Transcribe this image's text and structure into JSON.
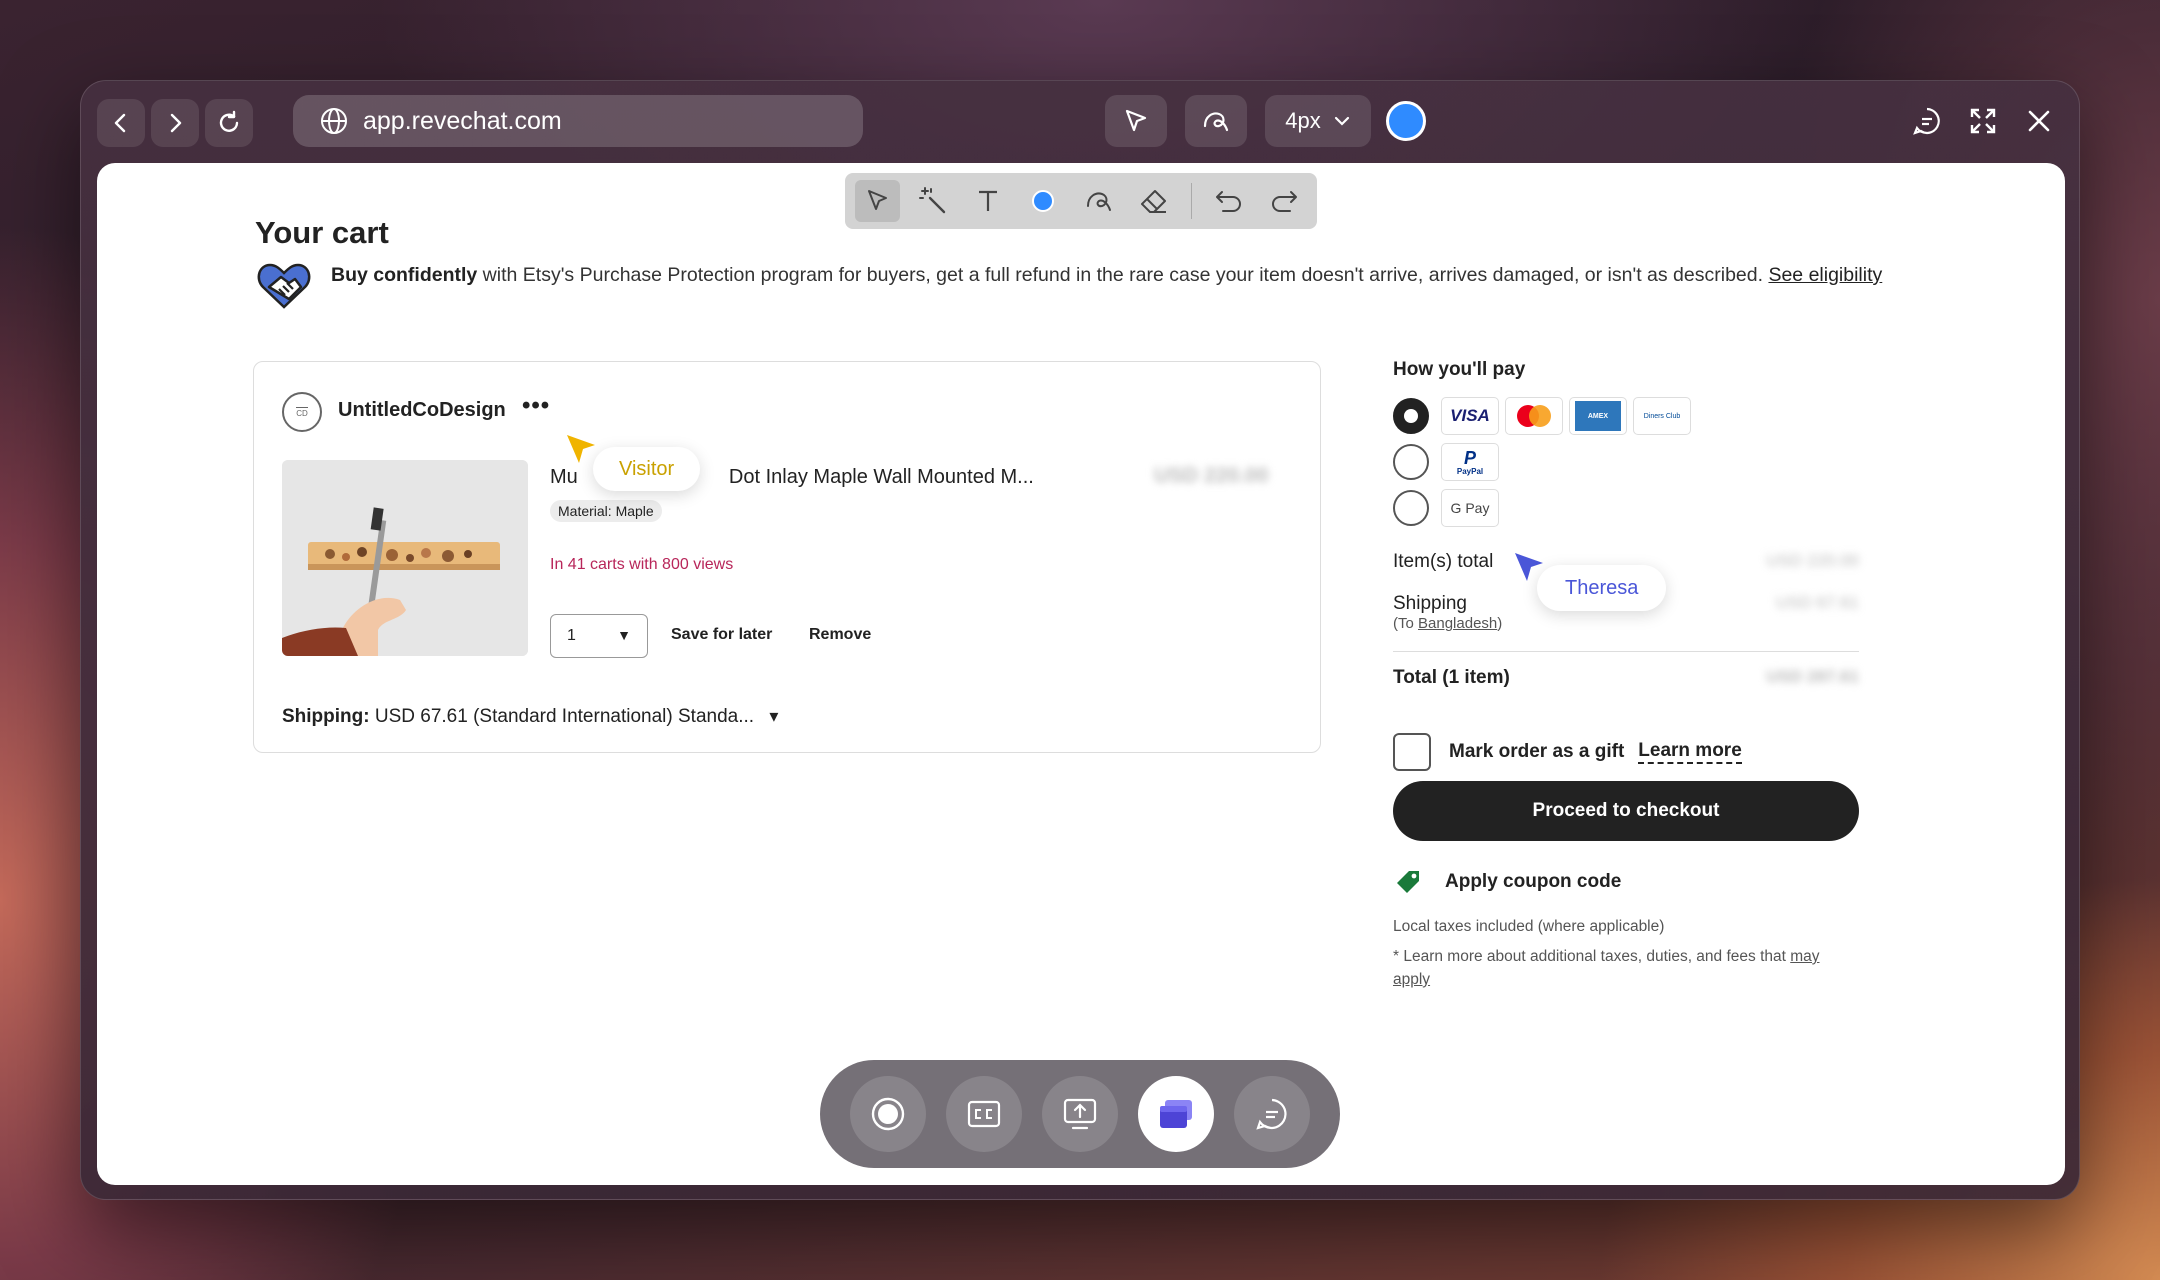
{
  "browser": {
    "url": "app.revechat.com",
    "stroke_size": "4px",
    "pen_color": "#2f8bff"
  },
  "page": {
    "title": "Your cart",
    "protection": {
      "bold": "Buy confidently",
      "text": " with Etsy's Purchase Protection program for buyers, get a full refund in the rare case your item doesn't arrive, arrives damaged, or isn't as described. ",
      "link": "See eligibility"
    },
    "cart": {
      "shop_name": "UntitledCoDesign",
      "shop_logo_text": "CD",
      "more": "•••",
      "product_title": "Mu ... Dot Inlay Maple Wall Mounted M...",
      "product_title_left": "Mu",
      "product_title_right": "Dot Inlay Maple Wall Mounted M...",
      "price": "USD 220.00",
      "material": "Material: Maple",
      "carts_note": "In 41 carts with 800 views",
      "quantity": "1",
      "save_for_later": "Save for later",
      "remove": "Remove",
      "shipping_label": "Shipping:",
      "shipping_value": " USD 67.61 (Standard International) Standa...",
      "shipping_caret": "▾"
    },
    "payment": {
      "heading": "How you'll pay",
      "cards": [
        "VISA",
        "Mastercard",
        "AMEX",
        "Diners Club"
      ],
      "paypal": "PayPal",
      "gpay": "G Pay",
      "items_total_label": "Item(s) total",
      "items_total_value": "USD 220.00",
      "shipping_label": "Shipping",
      "shipping_value": "USD 67.61",
      "to_prefix": "(To ",
      "to_country": "Bangladesh",
      "to_suffix": ")",
      "total_label": "Total (1 item)",
      "total_value": "USD 287.61",
      "gift_label": "Mark order as a gift",
      "learn_more": "Learn more",
      "checkout": "Proceed to checkout",
      "coupon": "Apply coupon code",
      "tax_note_1": "Local taxes included (where applicable)",
      "tax_note_2": "* Learn more about additional taxes, duties, and fees that ",
      "tax_note_link": "may apply"
    }
  },
  "cursors": {
    "visitor": "Visitor",
    "visitor_color": "#f0b400",
    "theresa": "Theresa",
    "theresa_color": "#4a56d8"
  },
  "bottom_bar": {
    "buttons": [
      "record",
      "captions",
      "share-screen",
      "co-browse",
      "chat"
    ]
  }
}
